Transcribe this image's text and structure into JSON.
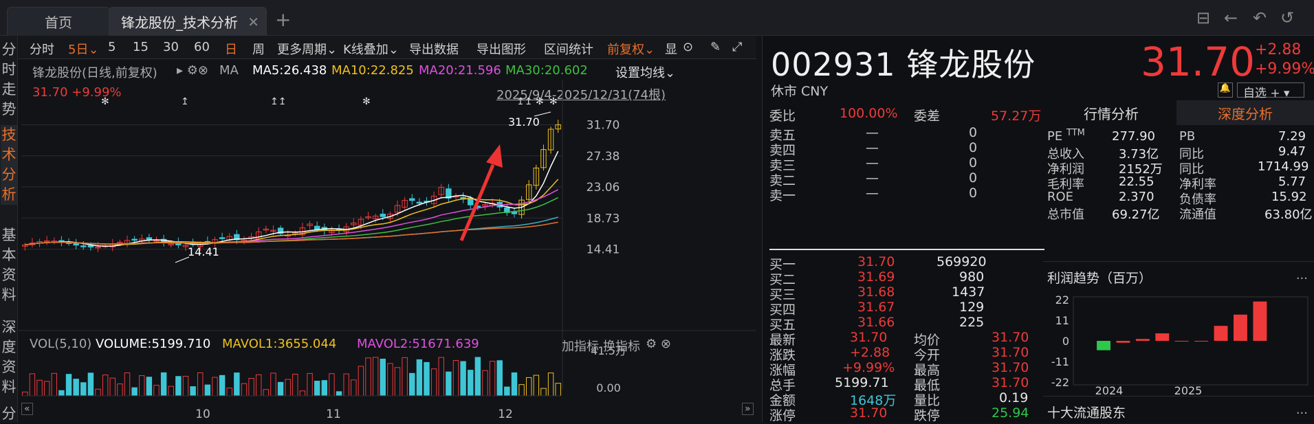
{
  "tabs": [
    {
      "label": "首页"
    },
    {
      "label": "锋龙股份_技术分析"
    }
  ],
  "left_nav": [
    {
      "label": "分时走势"
    },
    {
      "label": "技术分析"
    },
    {
      "label": "基本资料"
    },
    {
      "label": "深度资料"
    },
    {
      "label": "分"
    }
  ],
  "toolbar": {
    "items": [
      "分时",
      "5日",
      "5",
      "15",
      "30",
      "60",
      "日",
      "周",
      "更多周期",
      "K线叠加",
      "导出数据",
      "导出图形",
      "区间统计",
      "前复权",
      "显"
    ]
  },
  "chart_header": {
    "name": "锋龙股份(日线,前复权)",
    "ma_label": "MA",
    "ma5": "MA5:26.438",
    "ma10": "MA10:22.825",
    "ma20": "MA20:21.596",
    "ma30": "MA30:20.602",
    "setting": "设置均线",
    "price_line": "31.70 +9.99%",
    "range": "2025/9/4-2025/12/31(74根)"
  },
  "annotations": {
    "high_label": "31.70",
    "low_label": "14.41"
  },
  "chart_data": {
    "type": "candlestick",
    "yticks": [
      "31.70",
      "27.38",
      "23.06",
      "18.73",
      "14.41"
    ],
    "ylim": [
      13.5,
      33
    ],
    "xticks": [
      "10",
      "11",
      "12"
    ],
    "ma_colors": {
      "ma5": "#ffffff",
      "ma10": "#f0c020",
      "ma20": "#e050e0",
      "ma30": "#40c040"
    },
    "volume": {
      "label": "VOL(5,10)",
      "volume": "VOLUME:5199.710",
      "mavol1": "MAVOL1:3655.044",
      "mavol2": "MAVOL2:51671.639",
      "yticks": [
        "41.5万",
        "0.00"
      ],
      "actions": [
        "加指标",
        "换指标"
      ]
    }
  },
  "quote": {
    "code_name": "002931 锋龙股份",
    "price": "31.70",
    "change": "+2.88",
    "change_pct": "+9.99%",
    "status": "休市 CNY",
    "watch": "自选 +",
    "weibi_label": "委比",
    "weibi": "100.00%",
    "weicha_label": "委差",
    "weicha": "57.27万",
    "sell": [
      {
        "label": "卖五",
        "price": "—",
        "vol": "0"
      },
      {
        "label": "卖四",
        "price": "—",
        "vol": "0"
      },
      {
        "label": "卖三",
        "price": "—",
        "vol": "0"
      },
      {
        "label": "卖二",
        "price": "—",
        "vol": "0"
      },
      {
        "label": "卖一",
        "price": "—",
        "vol": "0"
      }
    ],
    "buy": [
      {
        "label": "买一",
        "price": "31.70",
        "vol": "569920"
      },
      {
        "label": "买二",
        "price": "31.69",
        "vol": "980"
      },
      {
        "label": "买三",
        "price": "31.68",
        "vol": "1437"
      },
      {
        "label": "买四",
        "price": "31.67",
        "vol": "129"
      },
      {
        "label": "买五",
        "price": "31.66",
        "vol": "225"
      }
    ],
    "stats": [
      {
        "l1": "最新",
        "v1": "31.70",
        "l2": "均价",
        "v2": "31.70"
      },
      {
        "l1": "涨跌",
        "v1": "+2.88",
        "l2": "今开",
        "v2": "31.70"
      },
      {
        "l1": "涨幅",
        "v1": "+9.99%",
        "l2": "最高",
        "v2": "31.70"
      },
      {
        "l1": "总手",
        "v1": "5199.71",
        "l2": "最低",
        "v2": "31.70"
      },
      {
        "l1": "金额",
        "v1": "1648万",
        "l2": "量比",
        "v2": "0.19"
      },
      {
        "l1": "涨停",
        "v1": "31.70",
        "l2": "跌停",
        "v2": "25.94"
      }
    ]
  },
  "fin": {
    "tab1": "行情分析",
    "tab2": "深度分析",
    "rows": [
      {
        "l1": "PE",
        "l1sub": "TTM",
        "v1": "277.90",
        "l2": "PB",
        "v2": "7.29"
      },
      {
        "l1": "总收入",
        "v1": "3.73亿",
        "l2": "同比",
        "v2": "9.47"
      },
      {
        "l1": "净利润",
        "v1": "2152万",
        "l2": "同比",
        "v2": "1714.99"
      },
      {
        "l1": "毛利率",
        "v1": "22.55",
        "l2": "净利率",
        "v2": "5.77"
      },
      {
        "l1": "ROE",
        "v1": "2.370",
        "l2": "负债率",
        "v2": "15.92"
      },
      {
        "l1": "总市值",
        "v1": "69.27亿",
        "l2": "流通值",
        "v2": "63.80亿"
      }
    ],
    "profit_title": "利润趋势（百万）",
    "profit_yticks": [
      "22",
      "11",
      "0",
      "-11",
      "-22"
    ],
    "profit_xticks": [
      "2024",
      "2025"
    ],
    "profit_bars": [
      -5,
      -1,
      1,
      4,
      0,
      0,
      8,
      14,
      21
    ],
    "holders_title": "十大流通股东"
  }
}
